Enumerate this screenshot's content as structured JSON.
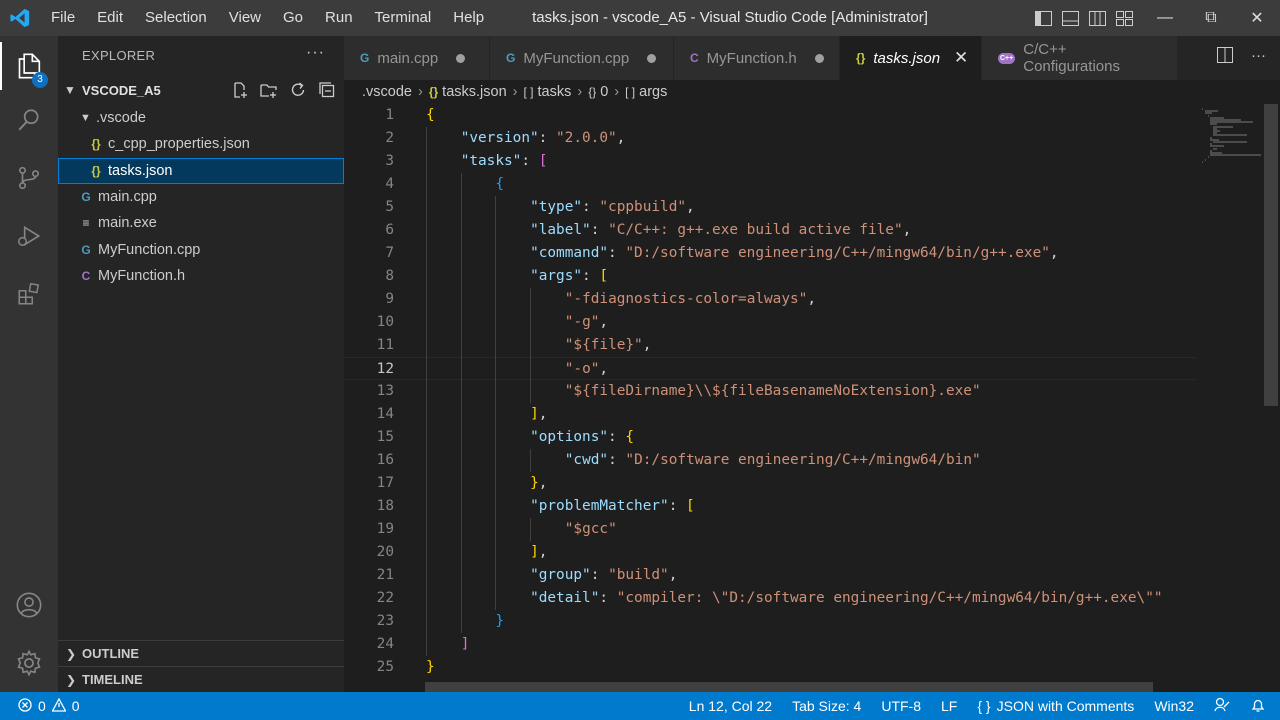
{
  "window": {
    "title": "tasks.json - vscode_A5 - Visual Studio Code [Administrator]"
  },
  "menu": [
    "File",
    "Edit",
    "Selection",
    "View",
    "Go",
    "Run",
    "Terminal",
    "Help"
  ],
  "activity": {
    "explorer_badge": "3"
  },
  "sidebar": {
    "title": "EXPLORER",
    "more": "···",
    "folder": "VSCODE_A5",
    "tree": [
      {
        "label": ".vscode",
        "kind": "folder"
      },
      {
        "label": "c_cpp_properties.json",
        "kind": "json",
        "icon": "{}"
      },
      {
        "label": "tasks.json",
        "kind": "json",
        "icon": "{}",
        "selected": true
      },
      {
        "label": "main.cpp",
        "kind": "cpp",
        "icon": "G"
      },
      {
        "label": "main.exe",
        "kind": "exe",
        "icon": "≡"
      },
      {
        "label": "MyFunction.cpp",
        "kind": "cpp",
        "icon": "G"
      },
      {
        "label": "MyFunction.h",
        "kind": "h",
        "icon": "C"
      }
    ],
    "outline": "OUTLINE",
    "timeline": "TIMELINE"
  },
  "tabs": [
    {
      "label": "main.cpp",
      "icon": "G",
      "dirty": true
    },
    {
      "label": "MyFunction.cpp",
      "icon": "G",
      "dirty": true
    },
    {
      "label": "MyFunction.h",
      "icon": "C",
      "dirty": true
    },
    {
      "label": "tasks.json",
      "icon": "{}",
      "active": true
    },
    {
      "label": "C/C++ Configurations",
      "icon": "C++"
    }
  ],
  "breadcrumb": {
    "folder": ".vscode",
    "file": "tasks.json",
    "p1": "tasks",
    "p2": "0",
    "p3": "args",
    "icon_obj": "{}",
    "icon_arr": "[ ]"
  },
  "editor": {
    "lines": [
      "{",
      "    \"version\": \"2.0.0\",",
      "    \"tasks\": [",
      "        {",
      "            \"type\": \"cppbuild\",",
      "            \"label\": \"C/C++: g++.exe build active file\",",
      "            \"command\": \"D:/software engineering/C++/mingw64/bin/g++.exe\",",
      "            \"args\": [",
      "                \"-fdiagnostics-color=always\",",
      "                \"-g\",",
      "                \"${file}\",",
      "                \"-o\",",
      "                \"${fileDirname}\\\\${fileBasenameNoExtension}.exe\"",
      "            ],",
      "            \"options\": {",
      "                \"cwd\": \"D:/software engineering/C++/mingw64/bin\"",
      "            },",
      "            \"problemMatcher\": [",
      "                \"$gcc\"",
      "            ],",
      "            \"group\": \"build\",",
      "            \"detail\": \"compiler: \\\"D:/software engineering/C++/mingw64/bin/g++.exe\\\"\"",
      "        }",
      "    ]",
      "}"
    ],
    "current_line": 12
  },
  "status": {
    "errors": "0",
    "warnings": "0",
    "position": "Ln 12, Col 22",
    "tab_size": "Tab Size: 4",
    "encoding": "UTF-8",
    "eol": "LF",
    "language": "JSON with Comments",
    "platform": "Win32"
  },
  "colors": {
    "accent": "#007acc",
    "key": "#9cdcfe",
    "string": "#ce9178",
    "bracket1": "#ffd700",
    "bracket2": "#da70d6",
    "bracket3": "#179fff"
  }
}
